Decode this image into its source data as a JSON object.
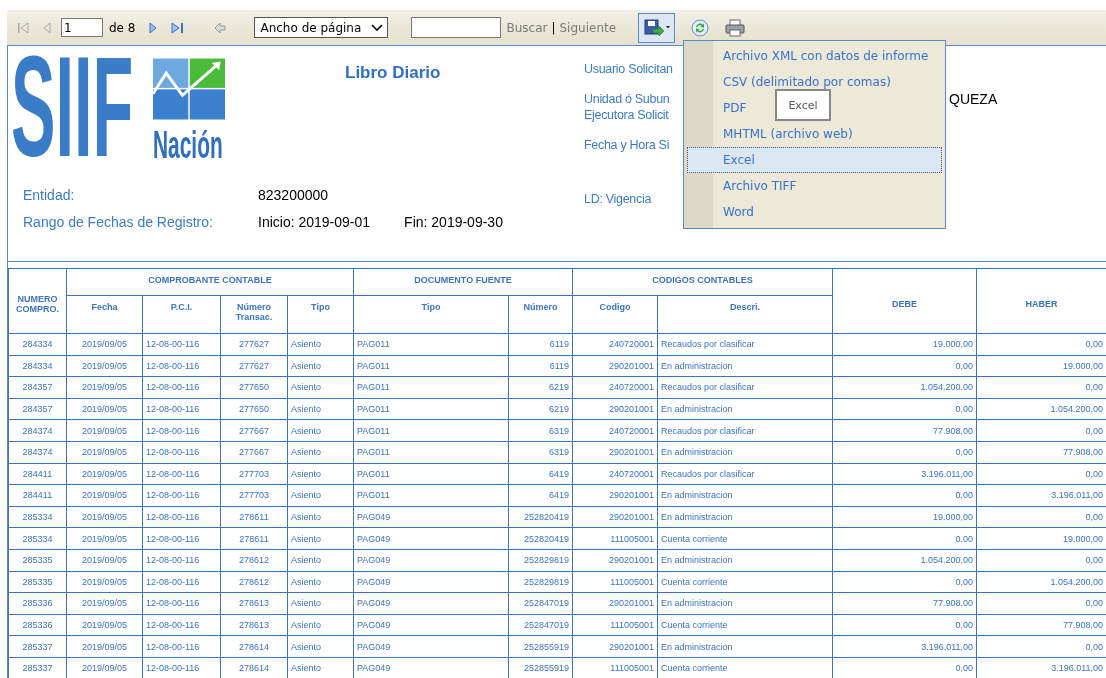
{
  "toolbar": {
    "page": "1",
    "page_count": "de 8",
    "zoom": "Ancho de página",
    "find": "Buscar",
    "find_separator": "|",
    "find_next": "Siguiente"
  },
  "export_menu": {
    "open": true,
    "items": [
      {
        "label": "Archivo XML con datos de informe",
        "selected": false
      },
      {
        "label": "CSV (delimitado por comas)",
        "selected": false
      },
      {
        "label": "PDF",
        "selected": false
      },
      {
        "label": "MHTML (archivo web)",
        "selected": false
      },
      {
        "label": "Excel",
        "selected": true
      },
      {
        "label": "Archivo TIFF",
        "selected": false
      },
      {
        "label": "Word",
        "selected": false
      }
    ]
  },
  "tooltip": "Excel",
  "report": {
    "logo": {
      "text": "SIIF",
      "subtitle": "Nación"
    },
    "title": "Libro Diario",
    "entity": {
      "label": "Entidad:",
      "value": "823200000"
    },
    "date_range": {
      "label": "Rango de Fechas de Registro:",
      "start": "Inicio: 2019-09-01",
      "end": "Fin: 2019-09-30"
    },
    "right_fields": [
      {
        "lines": [
          "Usuario Solicitan"
        ]
      },
      {
        "lines": [
          "Unidad ó Subun",
          "Ejecutora Solicit"
        ],
        "value": "QUEZA"
      },
      {
        "lines": [
          "Fecha y Hora Si"
        ]
      },
      {
        "lines": [
          "LD: Vigencia"
        ]
      }
    ]
  },
  "table": {
    "groups": [
      "COMPROBANTE CONTABLE",
      "DOCUMENTO FUENTE",
      "CODIGOS CONTABLES"
    ],
    "columns": [
      "NUMERO COMPRO.",
      "Fecha",
      "P.C.I.",
      "Número Transac.",
      "Tipo",
      "Tipo",
      "Número",
      "Codigo",
      "Descri.",
      "DEBE",
      "HABER"
    ],
    "rows": [
      [
        "284334",
        "2019/09/05",
        "12-08-00-116",
        "277627",
        "Asiento",
        "PAG011",
        "6119",
        "240720001",
        "Recaudos por clasificar",
        "19.000,00",
        "0,00"
      ],
      [
        "284334",
        "2019/09/05",
        "12-08-00-116",
        "277627",
        "Asiento",
        "PAG011",
        "6119",
        "290201001",
        "En administracion",
        "0,00",
        "19.000,00"
      ],
      [
        "284357",
        "2019/09/05",
        "12-08-00-116",
        "277650",
        "Asiento",
        "PAG011",
        "6219",
        "240720001",
        "Recaudos por clasificar",
        "1.054.200,00",
        "0,00"
      ],
      [
        "284357",
        "2019/09/05",
        "12-08-00-116",
        "277650",
        "Asiento",
        "PAG011",
        "6219",
        "290201001",
        "En administracion",
        "0,00",
        "1.054.200,00"
      ],
      [
        "284374",
        "2019/09/05",
        "12-08-00-116",
        "277667",
        "Asiento",
        "PAG011",
        "6319",
        "240720001",
        "Recaudos por clasificar",
        "77.908,00",
        "0,00"
      ],
      [
        "284374",
        "2019/09/05",
        "12-08-00-116",
        "277667",
        "Asiento",
        "PAG011",
        "6319",
        "290201001",
        "En administracion",
        "0,00",
        "77.908,00"
      ],
      [
        "284411",
        "2019/09/05",
        "12-08-00-116",
        "277703",
        "Asiento",
        "PAG011",
        "6419",
        "240720001",
        "Recaudos por clasificar",
        "3.196.011,00",
        "0,00"
      ],
      [
        "284411",
        "2019/09/05",
        "12-08-00-116",
        "277703",
        "Asiento",
        "PAG011",
        "6419",
        "290201001",
        "En administracion",
        "0,00",
        "3.196.011,00"
      ],
      [
        "285334",
        "2019/09/05",
        "12-08-00-116",
        "278611",
        "Asiento",
        "PAG049",
        "252820419",
        "290201001",
        "En administracion",
        "19.000,00",
        "0,00"
      ],
      [
        "285334",
        "2019/09/05",
        "12-08-00-116",
        "278611",
        "Asiento",
        "PAG049",
        "252820419",
        "111005001",
        "Cuenta corriente",
        "0,00",
        "19.000,00"
      ],
      [
        "285335",
        "2019/09/05",
        "12-08-00-116",
        "278612",
        "Asiento",
        "PAG049",
        "252829819",
        "290201001",
        "En administracion",
        "1.054.200,00",
        "0,00"
      ],
      [
        "285335",
        "2019/09/05",
        "12-08-00-116",
        "278612",
        "Asiento",
        "PAG049",
        "252829819",
        "111005001",
        "Cuenta corriente",
        "0,00",
        "1.054.200,00"
      ],
      [
        "285336",
        "2019/09/05",
        "12-08-00-116",
        "278613",
        "Asiento",
        "PAG049",
        "252847019",
        "290201001",
        "En administracion",
        "77.908,00",
        "0,00"
      ],
      [
        "285336",
        "2019/09/05",
        "12-08-00-116",
        "278613",
        "Asiento",
        "PAG049",
        "252847019",
        "111005001",
        "Cuenta corriente",
        "0,00",
        "77.908,00"
      ],
      [
        "285337",
        "2019/09/05",
        "12-08-00-116",
        "278614",
        "Asiento",
        "PAG049",
        "252855919",
        "290201001",
        "En administracion",
        "3.196.011,00",
        "0,00"
      ],
      [
        "285337",
        "2019/09/05",
        "12-08-00-116",
        "278614",
        "Asiento",
        "PAG049",
        "252855919",
        "111005001",
        "Cuenta corriente",
        "0,00",
        "3.196.011,00"
      ]
    ]
  }
}
